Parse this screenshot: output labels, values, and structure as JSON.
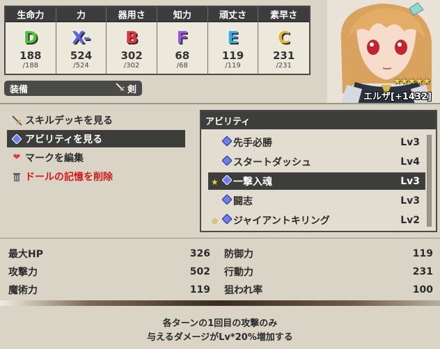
{
  "stats": [
    {
      "label": "生命力",
      "grade": "D",
      "color": "#4fc23d",
      "value": "188",
      "max": "/188"
    },
    {
      "label": "力",
      "grade": "X-",
      "color": "#5d63e3",
      "value": "524",
      "max": "/524"
    },
    {
      "label": "器用さ",
      "grade": "B",
      "color": "#e2363a",
      "value": "302",
      "max": "/302"
    },
    {
      "label": "知力",
      "grade": "F",
      "color": "#9b56d6",
      "value": "68",
      "max": "/68"
    },
    {
      "label": "頑丈さ",
      "grade": "E",
      "color": "#3ea9de",
      "value": "119",
      "max": "/119"
    },
    {
      "label": "素早さ",
      "grade": "C",
      "color": "#e7b53a",
      "value": "231",
      "max": "/231"
    }
  ],
  "equipment": {
    "label": "装備",
    "weapon": "剣",
    "weapon_icon": "sword-icon"
  },
  "character": {
    "stars": "★★★★★",
    "name": "エルザ[+1432]"
  },
  "menu": [
    {
      "label": "スキルデッキを見る",
      "icon": "sword-icon"
    },
    {
      "label": "アビリティを見る",
      "icon": "diamond-icon"
    },
    {
      "label": "マークを編集",
      "icon": "heart-icon"
    },
    {
      "label": "ドールの記憶を削除",
      "icon": "trash-icon"
    }
  ],
  "abilities": {
    "title": "アビリティ",
    "items": [
      {
        "name": "先手必勝",
        "level": "Lv3",
        "starred": false
      },
      {
        "name": "スタートダッシュ",
        "level": "Lv4",
        "starred": false
      },
      {
        "name": "一撃入魂",
        "level": "Lv3",
        "starred": true
      },
      {
        "name": "闘志",
        "level": "Lv3",
        "starred": false
      },
      {
        "name": "ジャイアントキリング",
        "level": "Lv2",
        "starred": true
      }
    ]
  },
  "combat_stats": {
    "left": [
      {
        "label": "最大HP",
        "value": "326"
      },
      {
        "label": "攻撃力",
        "value": "502"
      },
      {
        "label": "魔術力",
        "value": "119"
      }
    ],
    "right": [
      {
        "label": "防御力",
        "value": "119"
      },
      {
        "label": "行動力",
        "value": "231"
      },
      {
        "label": "狙われ率",
        "value": "100"
      }
    ]
  },
  "description": {
    "line1": "各ターンの1回目の攻撃のみ",
    "line2": "与えるダメージがLv*20%増加する"
  }
}
